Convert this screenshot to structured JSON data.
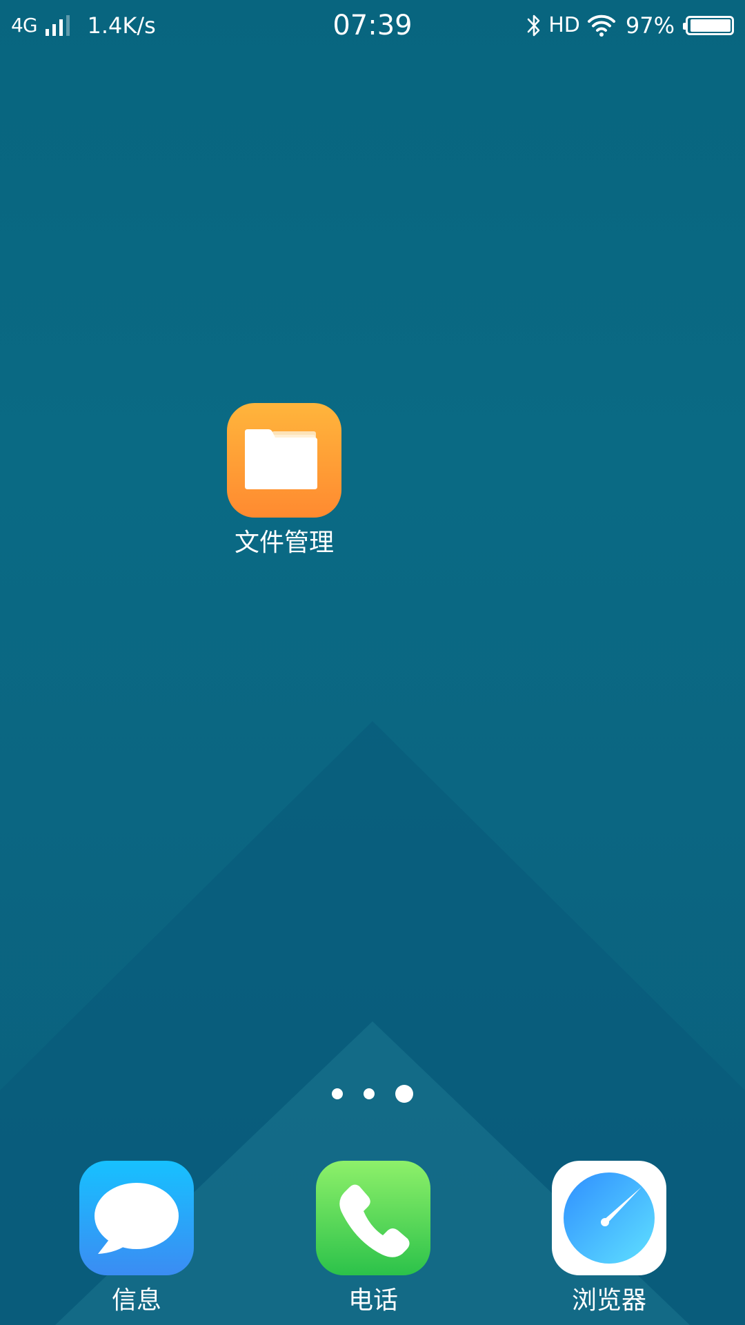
{
  "status_bar": {
    "network_type": "4G",
    "net_speed": "1.4K/s",
    "time": "07:39",
    "hd_label": "HD",
    "battery_percent": "97%",
    "battery_level": 0.97,
    "icons": [
      "signal-icon",
      "bluetooth-icon",
      "wifi-icon",
      "battery-icon"
    ]
  },
  "home": {
    "apps": [
      {
        "label": "文件管理",
        "icon": "folder-icon",
        "color": "#ff9a35"
      }
    ],
    "page_indicator": {
      "pages": 3,
      "current": 3
    }
  },
  "dock": {
    "apps": [
      {
        "label": "信息",
        "icon": "message-bubble-icon",
        "color": "#2aa6ff"
      },
      {
        "label": "电话",
        "icon": "phone-handset-icon",
        "color": "#3fcf4f"
      },
      {
        "label": "浏览器",
        "icon": "compass-icon",
        "color": "#3aa8ff"
      }
    ]
  },
  "colors": {
    "wallpaper": "#0a6a84",
    "wallpaper_dark": "#0a4f75"
  }
}
